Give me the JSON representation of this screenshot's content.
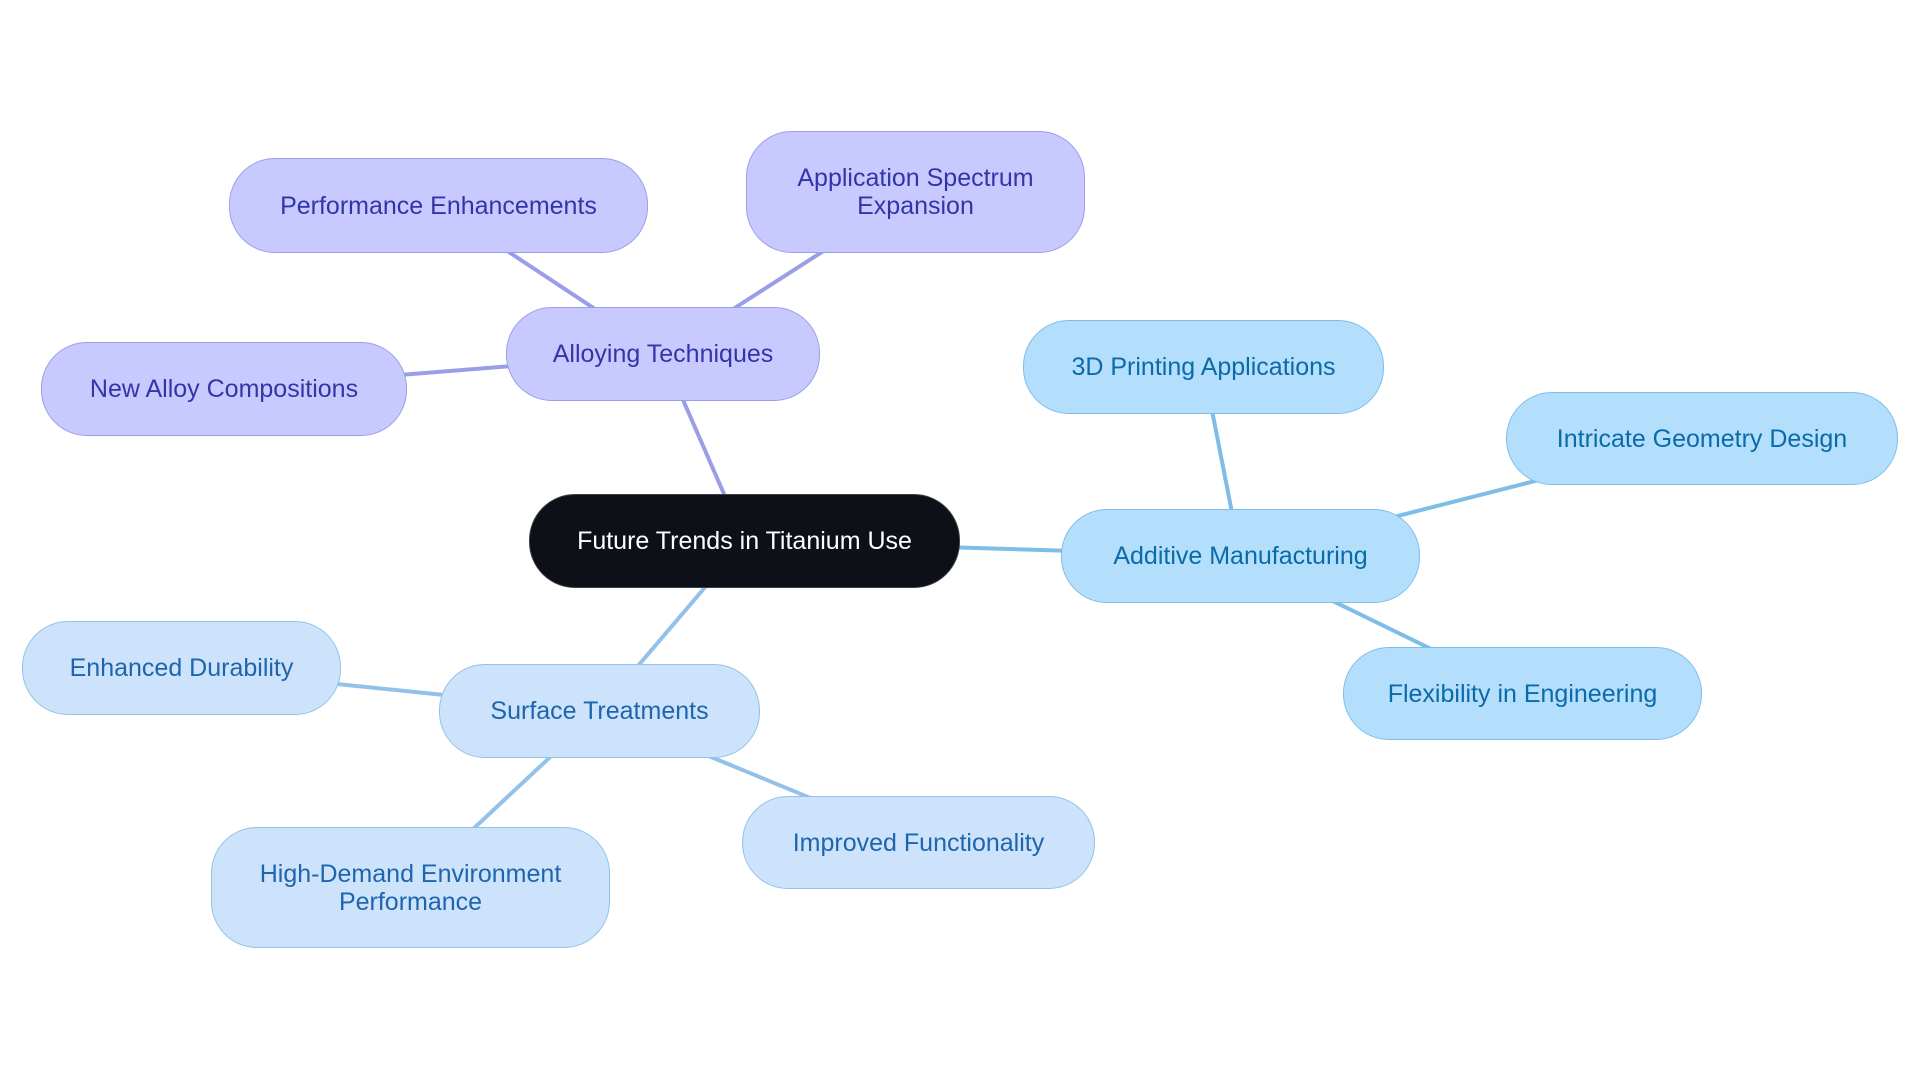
{
  "diagram": {
    "type": "mind-map",
    "root": {
      "id": "n-center",
      "label": "Future Trends in Titanium Use",
      "color": "#0d1117"
    },
    "branches": [
      {
        "id": "n-alloy",
        "label": "Alloying Techniques",
        "color_group": "purple",
        "children": [
          {
            "id": "n-perf",
            "label": "Performance Enhancements"
          },
          {
            "id": "n-app",
            "label": "Application Spectrum\nExpansion"
          },
          {
            "id": "n-newalloy",
            "label": "New Alloy Compositions"
          }
        ]
      },
      {
        "id": "n-additive",
        "label": "Additive Manufacturing",
        "color_group": "sky",
        "children": [
          {
            "id": "n-3d",
            "label": "3D Printing Applications"
          },
          {
            "id": "n-intricate",
            "label": "Intricate Geometry Design"
          },
          {
            "id": "n-flex",
            "label": "Flexibility in Engineering"
          }
        ]
      },
      {
        "id": "n-surface",
        "label": "Surface Treatments",
        "color_group": "pale",
        "children": [
          {
            "id": "n-durable",
            "label": "Enhanced Durability"
          },
          {
            "id": "n-highdemand",
            "label": "High-Demand Environment\nPerformance"
          },
          {
            "id": "n-improved",
            "label": "Improved Functionality"
          }
        ]
      }
    ],
    "colors": {
      "purple_fill": "#c8caff",
      "purple_edge": "#9a9ee6",
      "purple_text": "#3235a8",
      "sky_fill": "#b3dffc",
      "sky_edge": "#7fbde8",
      "sky_text": "#0b6aa8",
      "pale_fill": "#cce3fb",
      "pale_edge": "#93c1ea",
      "pale_text": "#1e65ad"
    }
  }
}
